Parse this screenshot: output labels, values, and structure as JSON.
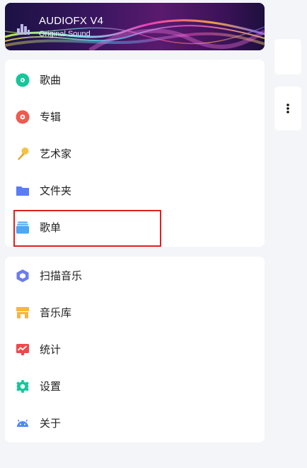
{
  "header": {
    "title": "AUDIOFX V4",
    "subtitle": "Original Sound"
  },
  "library": {
    "items": [
      {
        "label": "歌曲",
        "icon": "songs-icon"
      },
      {
        "label": "专辑",
        "icon": "album-icon"
      },
      {
        "label": "艺术家",
        "icon": "artist-icon"
      },
      {
        "label": "文件夹",
        "icon": "folder-icon"
      },
      {
        "label": "歌单",
        "icon": "playlist-icon"
      }
    ]
  },
  "tools": {
    "items": [
      {
        "label": "扫描音乐",
        "icon": "scan-icon"
      },
      {
        "label": "音乐库",
        "icon": "music-library-icon"
      },
      {
        "label": "统计",
        "icon": "stats-icon"
      },
      {
        "label": "设置",
        "icon": "settings-icon"
      },
      {
        "label": "关于",
        "icon": "android-icon"
      }
    ]
  },
  "colors": {
    "songs": "#16c79a",
    "album": "#f05a4f",
    "artist": "#f6c244",
    "folder": "#5b7cf7",
    "playlist": "#4aa8f4",
    "scan": "#6c7cf0",
    "library": "#f6b73c",
    "stats": "#f0494a",
    "settings": "#16c79a",
    "about": "#4a8af4",
    "highlight": "#e02020"
  }
}
